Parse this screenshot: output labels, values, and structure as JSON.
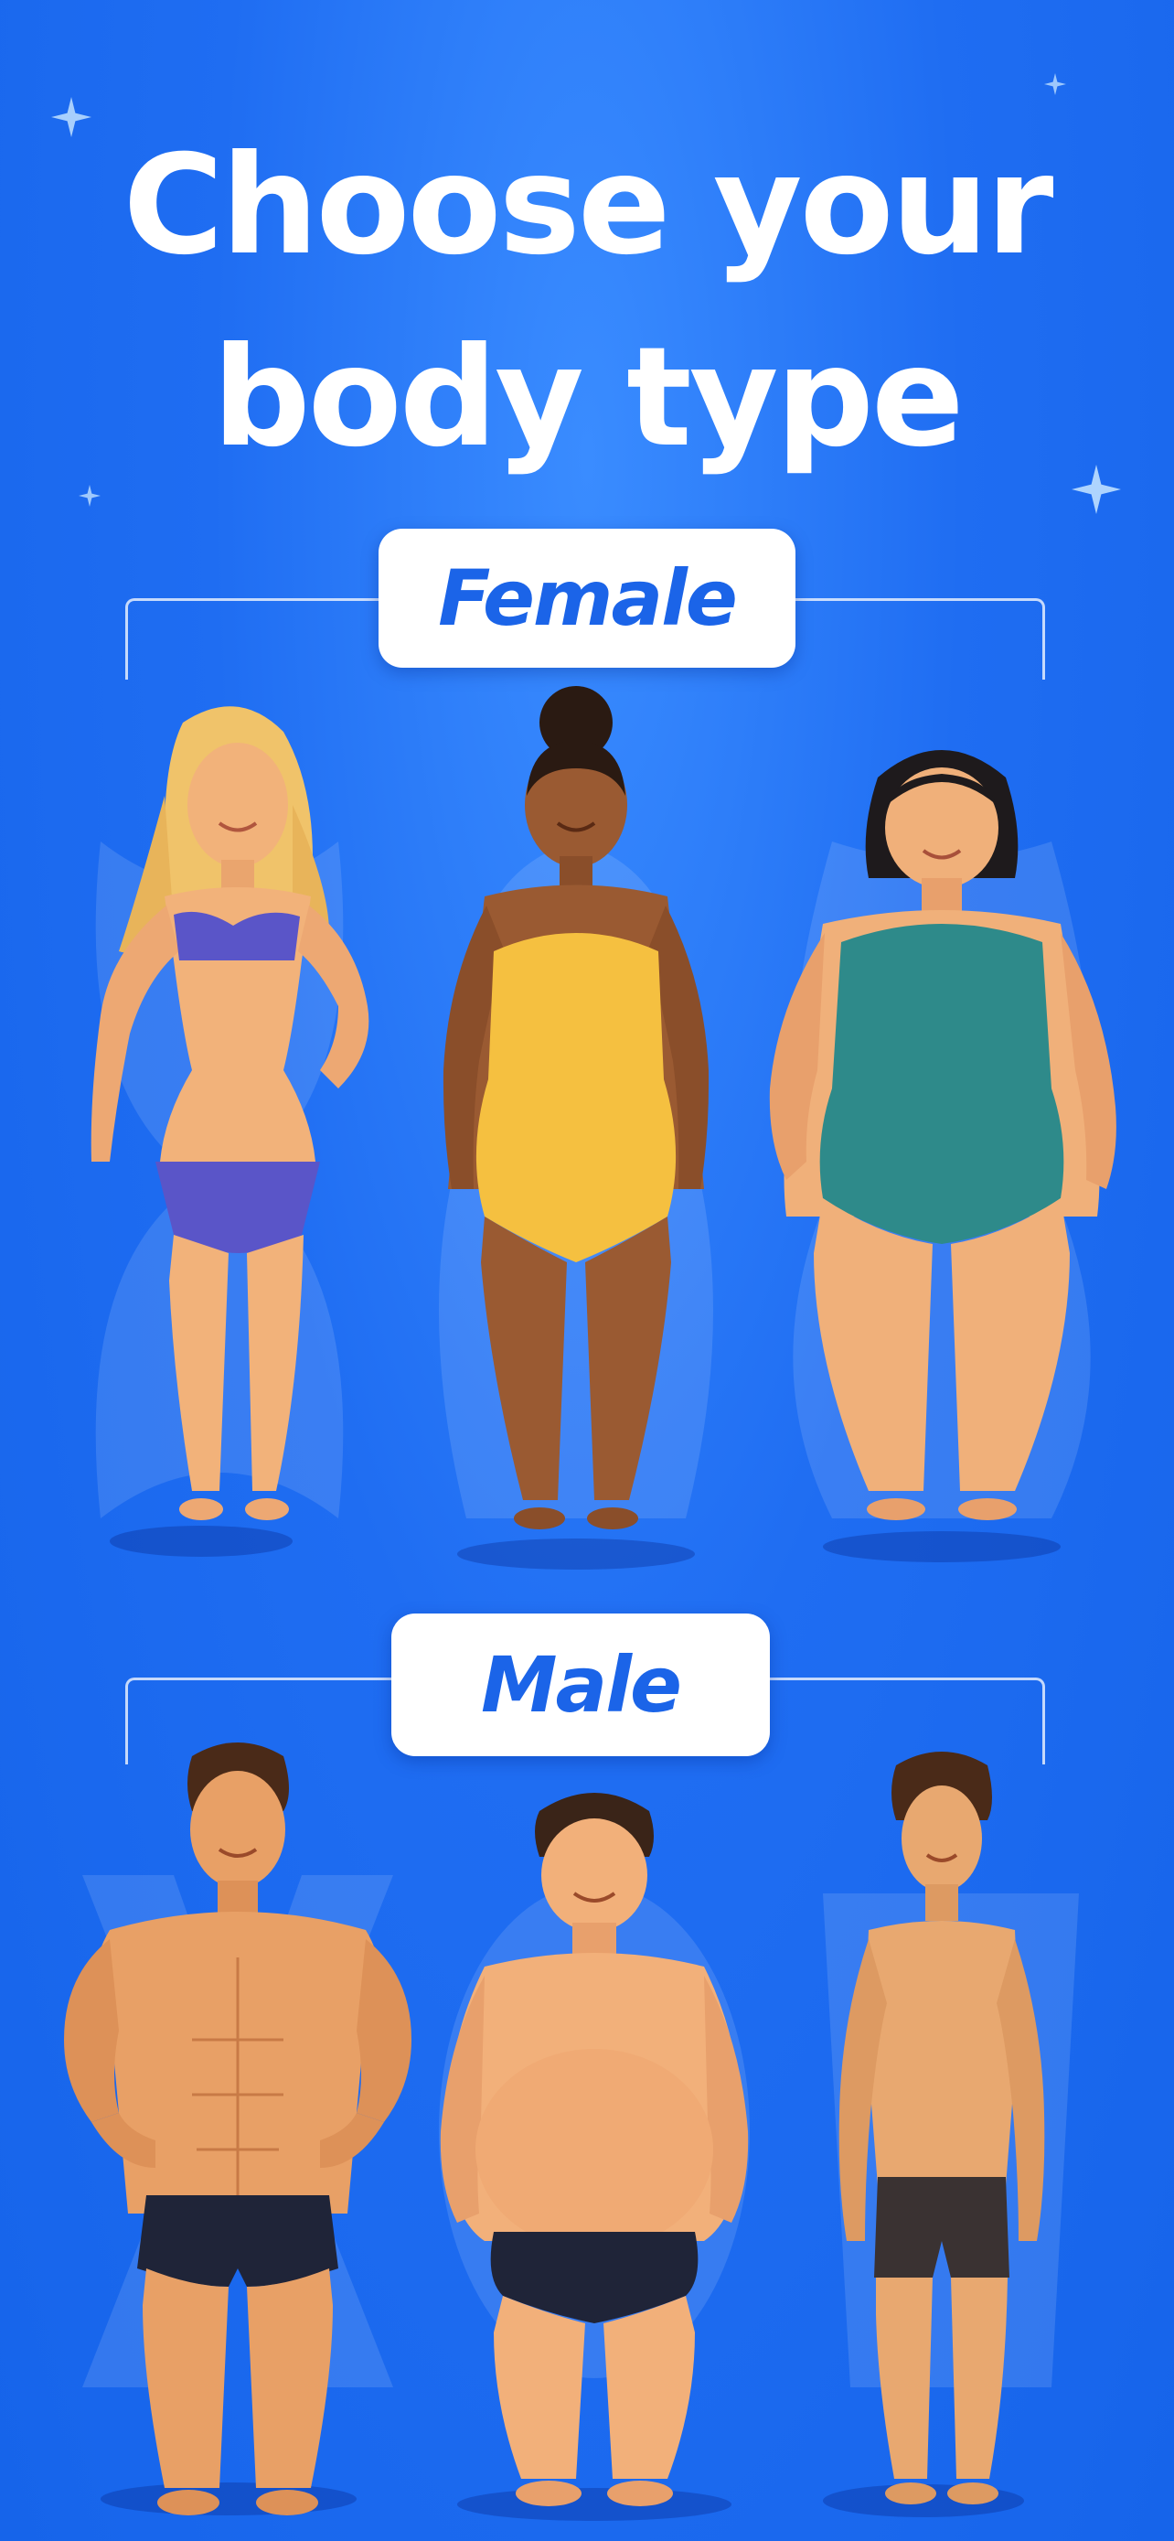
{
  "screen": {
    "title_line1": "Choose your",
    "title_line2": "body type",
    "background_color": "#1f6df2",
    "accent_color": "#1b64e8"
  },
  "female": {
    "label": "Female",
    "figures": [
      {
        "name": "slim-blonde-woman",
        "swimsuit_color": "#5a55c8"
      },
      {
        "name": "curvy-woman",
        "swimsuit_color": "#f5c040"
      },
      {
        "name": "plus-size-woman",
        "swimsuit_color": "#2e8a8a"
      }
    ]
  },
  "male": {
    "label": "Male",
    "figures": [
      {
        "name": "muscular-man",
        "shorts_color": "#1f2438"
      },
      {
        "name": "heavy-man",
        "shorts_color": "#1f2438"
      },
      {
        "name": "slim-man",
        "shorts_color": "#3a3232"
      }
    ]
  },
  "icons": [
    "sparkle-icon"
  ]
}
